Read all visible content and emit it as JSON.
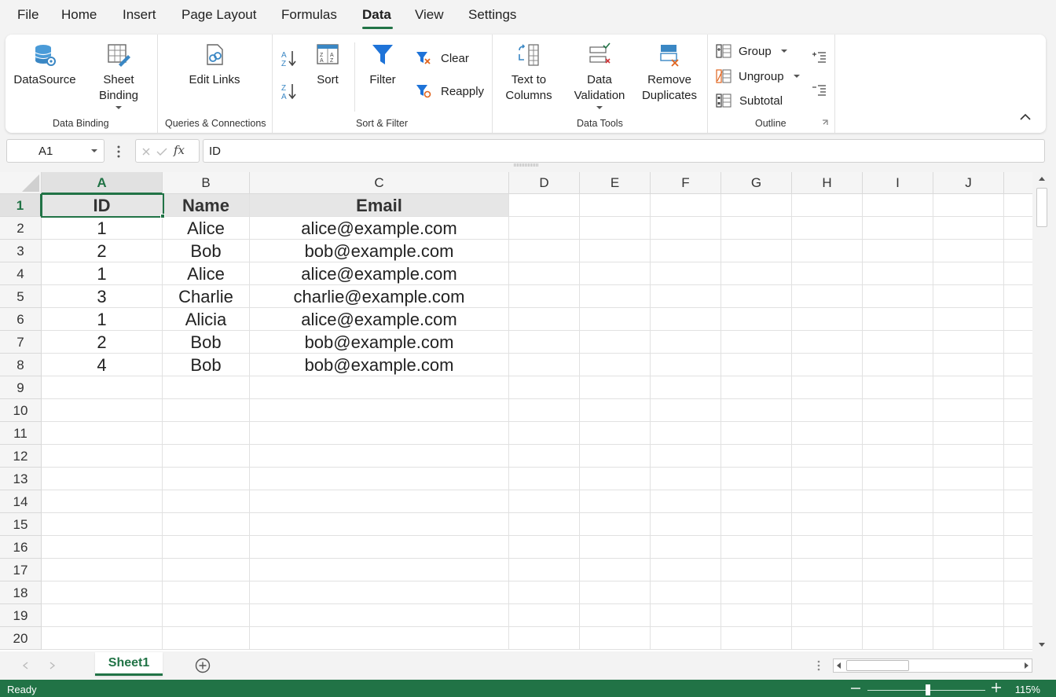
{
  "menu": {
    "items": [
      "File",
      "Home",
      "Insert",
      "Page Layout",
      "Formulas",
      "Data",
      "View",
      "Settings"
    ],
    "active": "Data"
  },
  "ribbon": {
    "datasource": "DataSource",
    "sheet_binding_1": "Sheet",
    "sheet_binding_2": "Binding",
    "group_data_binding": "Data Binding",
    "edit_links": "Edit Links",
    "group_queries": "Queries & Connections",
    "sort": "Sort",
    "filter": "Filter",
    "clear": "Clear",
    "reapply": "Reapply",
    "group_sort_filter": "Sort & Filter",
    "text_to_columns_1": "Text to",
    "text_to_columns_2": "Columns",
    "data_validation_1": "Data",
    "data_validation_2": "Validation",
    "remove_duplicates_1": "Remove",
    "remove_duplicates_2": "Duplicates",
    "group_data_tools": "Data Tools",
    "group": "Group",
    "ungroup": "Ungroup",
    "subtotal": "Subtotal",
    "group_outline": "Outline"
  },
  "formula_bar": {
    "name_box": "A1",
    "fx": "fx",
    "formula": "ID"
  },
  "sheet": {
    "columns": [
      "A",
      "B",
      "C",
      "D",
      "E",
      "F",
      "G",
      "H",
      "I",
      "J"
    ],
    "selected_column": "A",
    "rows": [
      "1",
      "2",
      "3",
      "4",
      "5",
      "6",
      "7",
      "8",
      "9",
      "10",
      "11",
      "12",
      "13",
      "14",
      "15",
      "16",
      "17",
      "18",
      "19",
      "20"
    ],
    "selected_row": "1",
    "data": [
      [
        "ID",
        "Name",
        "Email"
      ],
      [
        "1",
        "Alice",
        "alice@example.com"
      ],
      [
        "2",
        "Bob",
        "bob@example.com"
      ],
      [
        "1",
        "Alice",
        "alice@example.com"
      ],
      [
        "3",
        "Charlie",
        "charlie@example.com"
      ],
      [
        "1",
        "Alicia",
        "alice@example.com"
      ],
      [
        "2",
        "Bob",
        "bob@example.com"
      ],
      [
        "4",
        "Bob",
        "bob@example.com"
      ]
    ]
  },
  "tabs": {
    "sheet1": "Sheet1"
  },
  "status": {
    "ready": "Ready",
    "zoom": "115%"
  },
  "colors": {
    "accent": "#217346",
    "filter_blue": "#1e73d8"
  }
}
